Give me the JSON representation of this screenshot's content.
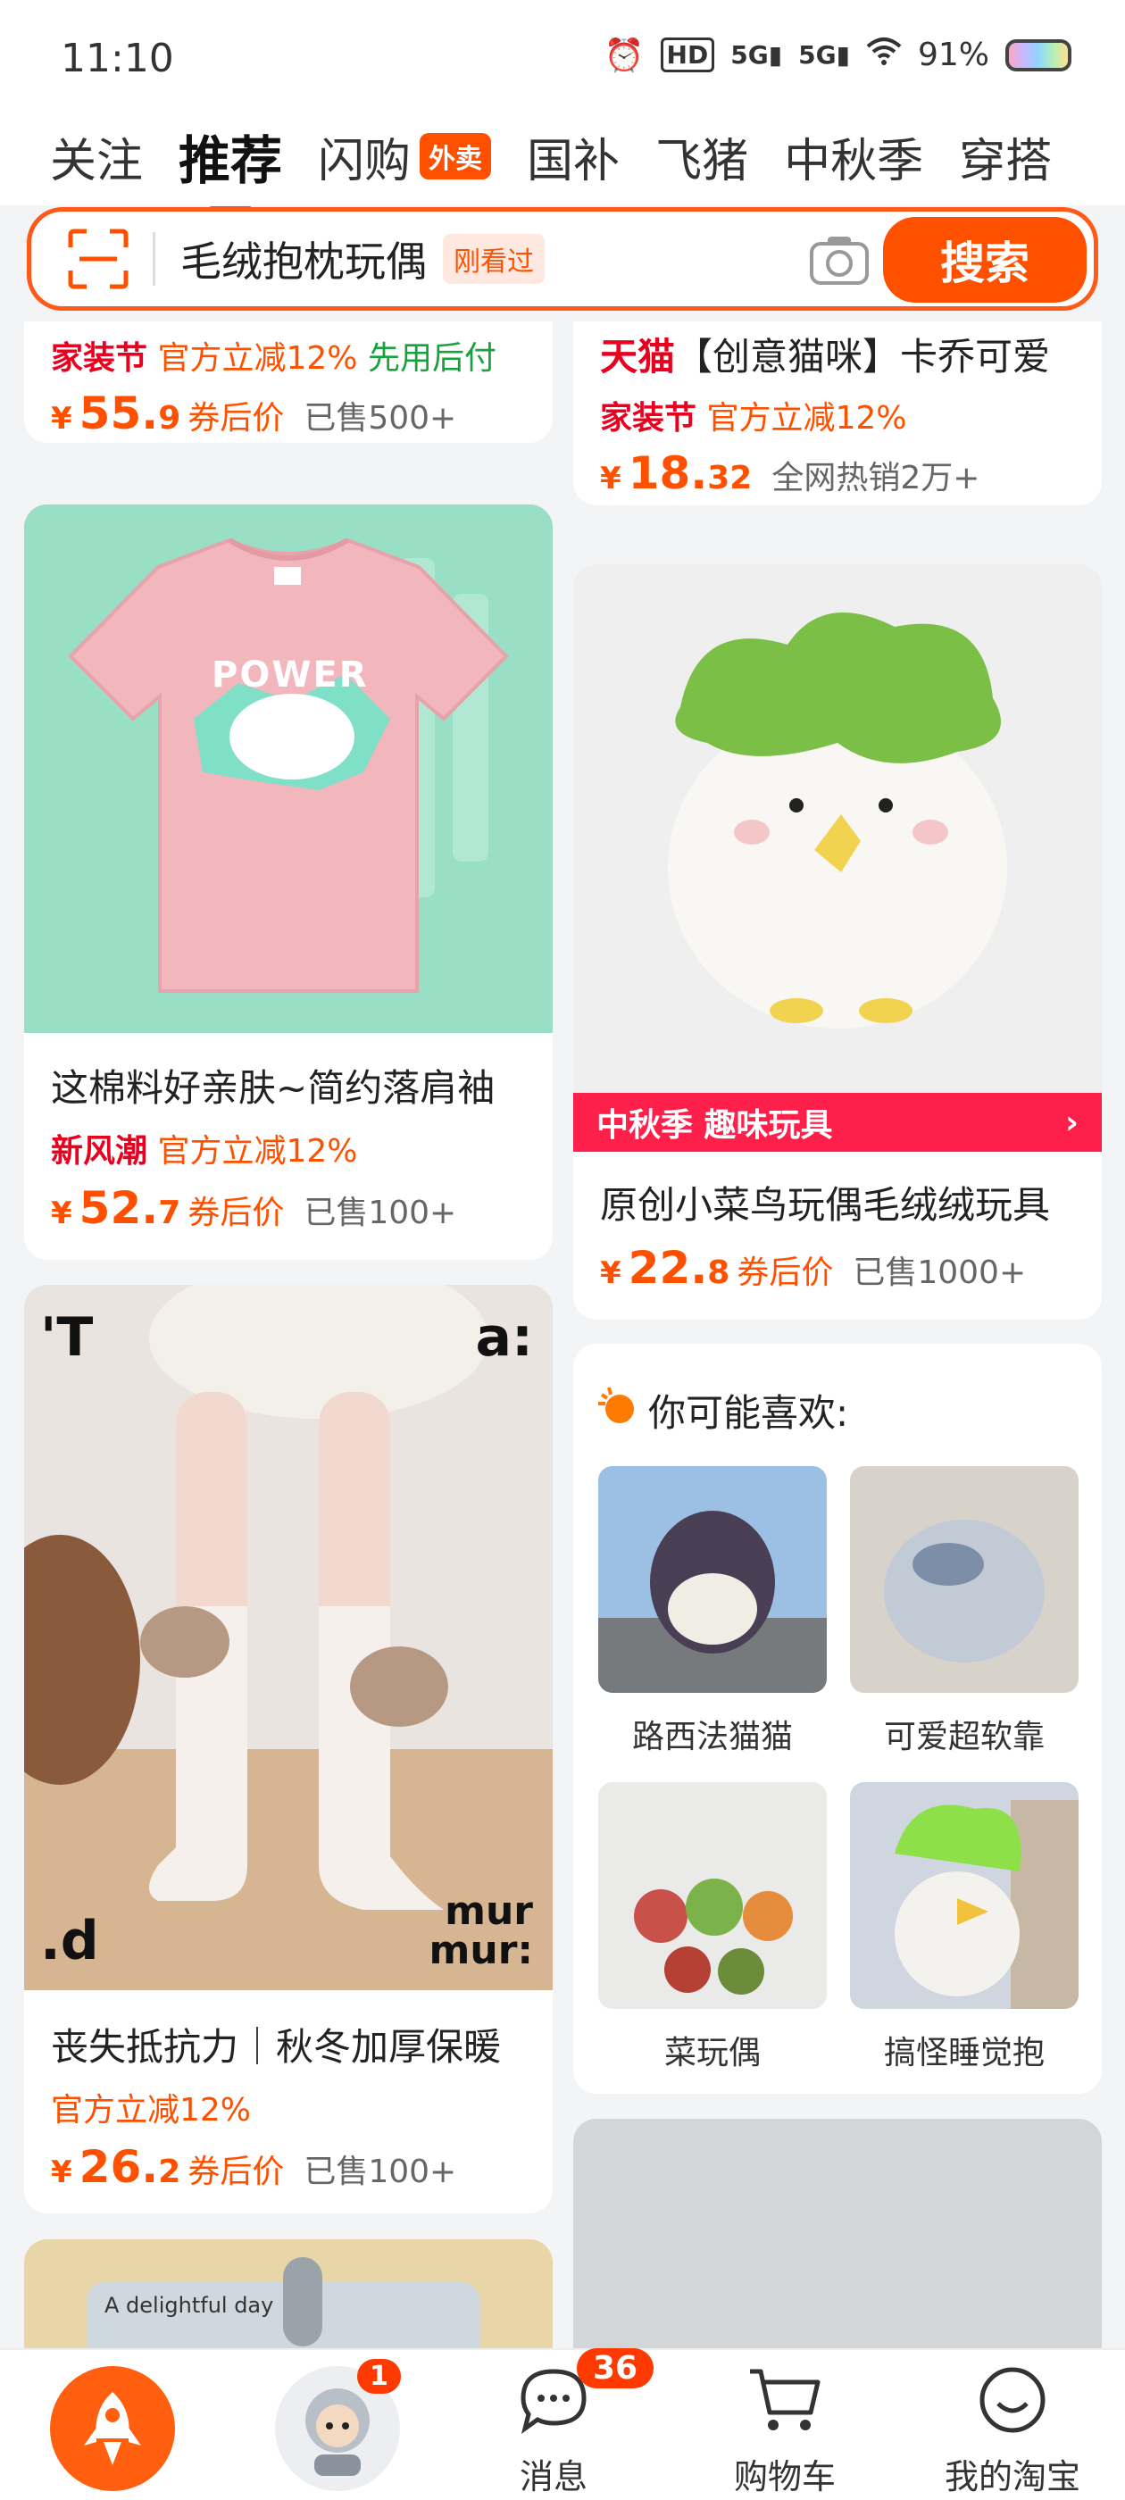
{
  "status_bar": {
    "time": "11:10",
    "battery": "91%",
    "icons": [
      "alarm-icon",
      "hd-icon",
      "5g-signal-icon",
      "5g-signal-icon",
      "wifi-icon",
      "battery-icon"
    ]
  },
  "tabs": [
    {
      "label": "关注"
    },
    {
      "label": "推荐"
    },
    {
      "label": "闪购",
      "badge": "外卖"
    },
    {
      "label": "国补"
    },
    {
      "label": "飞猪"
    },
    {
      "label": "中秋季"
    },
    {
      "label": "穿搭"
    }
  ],
  "search": {
    "query": "毛绒抱枕玩偶",
    "recent_tag": "刚看过",
    "button": "搜索"
  },
  "cards": {
    "left_top": {
      "tags": [
        "家装节",
        "官方立减12%",
        "先用后付"
      ],
      "price_int": "55.",
      "price_dec": "9",
      "price_after": "券后价",
      "sold": "已售500+"
    },
    "right_top": {
      "title": "【创意猫咪】卡乔可爱",
      "brand": "天猫",
      "tags": [
        "家装节",
        "官方立减12%"
      ],
      "price_int": "18.",
      "price_dec": "32",
      "sold": "全网热销2万+"
    },
    "tshirt": {
      "title": "这棉料好亲肤~简约落肩袖",
      "tags": [
        "新风潮",
        "官方立减12%"
      ],
      "price_int": "52.",
      "price_dec": "7",
      "price_after": "券后价",
      "sold": "已售100+",
      "print_text": "POWER"
    },
    "bird": {
      "banner": "中秋季 趣味玩具",
      "title": "原创小菜鸟玩偶毛绒绒玩具",
      "price_int": "22.",
      "price_dec": "8",
      "price_after": "券后价",
      "sold": "已售1000+"
    },
    "socks": {
      "title": "丧失抵抗力｜秋冬加厚保暖",
      "tags": [
        "官方立减12%"
      ],
      "price_int": "26.",
      "price_dec": "2",
      "price_after": "券后价",
      "sold": "已售100+",
      "corner_tl": "'T",
      "corner_tr": "a:",
      "corner_bl": ".d",
      "corner_br": "mur mur:"
    },
    "bottom_peek": {
      "text": "A delightful day"
    }
  },
  "recommend": {
    "title": "你可能喜欢:",
    "items": [
      {
        "label": "路西法猫猫"
      },
      {
        "label": "可爱超软靠"
      },
      {
        "label": "菜玩偶"
      },
      {
        "label": "搞怪睡觉抱"
      }
    ]
  },
  "bottom_nav": {
    "profile_badge": "1",
    "messages": "消息",
    "messages_badge": "36",
    "cart": "购物车",
    "mine": "我的淘宝"
  },
  "colors": {
    "accent": "#ff5000",
    "tmall_red": "#e8001e",
    "green": "#17a23b"
  }
}
